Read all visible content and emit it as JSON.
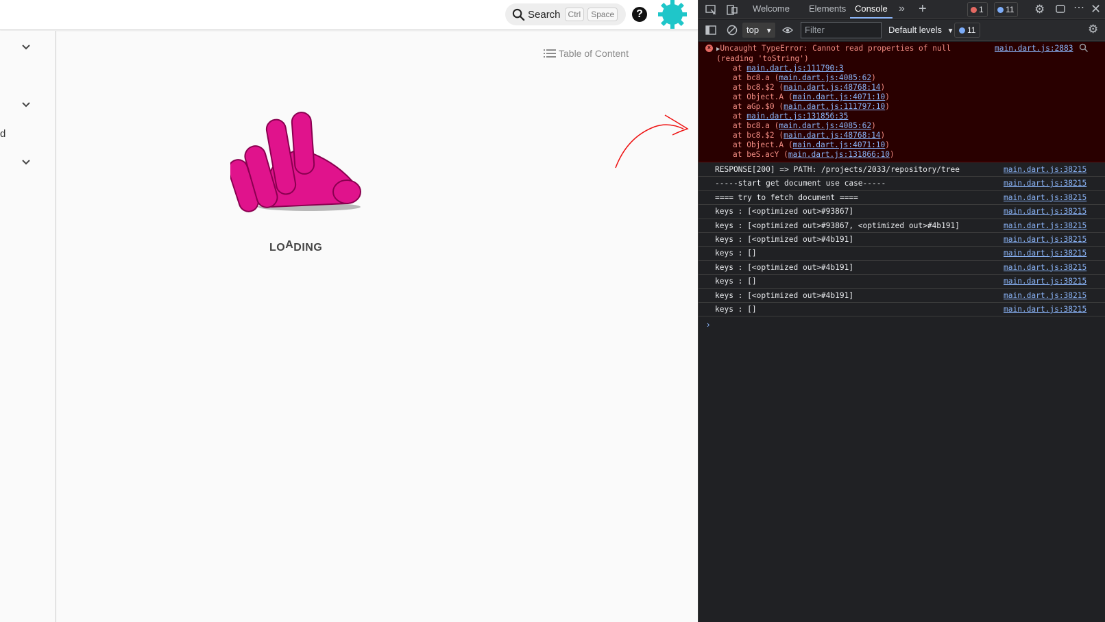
{
  "app": {
    "search": {
      "label": "Search",
      "key1": "Ctrl",
      "key2": "Space"
    },
    "help": "?",
    "rail_letter": "d",
    "toc_label": "Table of Content",
    "loading": {
      "pre": "LO",
      "mid": "A",
      "post": "DING"
    }
  },
  "devtools": {
    "tabs": [
      "Welcome",
      "Elements",
      "Console"
    ],
    "error_count": "1",
    "message_count": "11",
    "context": "top",
    "filter_placeholder": "Filter",
    "levels": "Default levels",
    "levels_count": "11",
    "error": {
      "message": "Uncaught TypeError: Cannot read properties of null (reading 'toString')",
      "source": "main.dart.js:2883",
      "stack": [
        {
          "pre": "at ",
          "fn": "",
          "link": "main.dart.js:111790:3"
        },
        {
          "pre": "at bc8.a (",
          "fn": "",
          "link": "main.dart.js:4085:62",
          "post": ")"
        },
        {
          "pre": "at bc8.$2 (",
          "fn": "",
          "link": "main.dart.js:48768:14",
          "post": ")"
        },
        {
          "pre": "at Object.A (",
          "fn": "",
          "link": "main.dart.js:4071:10",
          "post": ")"
        },
        {
          "pre": "at aGp.$0 (",
          "fn": "",
          "link": "main.dart.js:111797:10",
          "post": ")"
        },
        {
          "pre": "at ",
          "fn": "",
          "link": "main.dart.js:131856:35"
        },
        {
          "pre": "at bc8.a (",
          "fn": "",
          "link": "main.dart.js:4085:62",
          "post": ")"
        },
        {
          "pre": "at bc8.$2 (",
          "fn": "",
          "link": "main.dart.js:48768:14",
          "post": ")"
        },
        {
          "pre": "at Object.A (",
          "fn": "",
          "link": "main.dart.js:4071:10",
          "post": ")"
        },
        {
          "pre": "at beS.acY (",
          "fn": "",
          "link": "main.dart.js:131866:10",
          "post": ")"
        }
      ]
    },
    "logs": [
      {
        "msg": "RESPONSE[200] => PATH: /projects/2033/repository/tree",
        "src": "main.dart.js:38215"
      },
      {
        "msg": "-----start get document use case-----",
        "src": "main.dart.js:38215"
      },
      {
        "msg": "==== try to fetch document ====",
        "src": "main.dart.js:38215"
      },
      {
        "msg": "keys : [<optimized out>#93867]",
        "src": "main.dart.js:38215"
      },
      {
        "msg": "keys : [<optimized out>#93867, <optimized out>#4b191]",
        "src": "main.dart.js:38215"
      },
      {
        "msg": "keys : [<optimized out>#4b191]",
        "src": "main.dart.js:38215"
      },
      {
        "msg": "keys : []",
        "src": "main.dart.js:38215"
      },
      {
        "msg": "keys : [<optimized out>#4b191]",
        "src": "main.dart.js:38215"
      },
      {
        "msg": "keys : []",
        "src": "main.dart.js:38215"
      },
      {
        "msg": "keys : [<optimized out>#4b191]",
        "src": "main.dart.js:38215"
      },
      {
        "msg": "keys : []",
        "src": "main.dart.js:38215"
      }
    ],
    "prompt": "›"
  },
  "colors": {
    "accent": "#e0138c",
    "link": "#8ab4f8",
    "error_bg": "#290000",
    "error_text": "#f28b82"
  }
}
